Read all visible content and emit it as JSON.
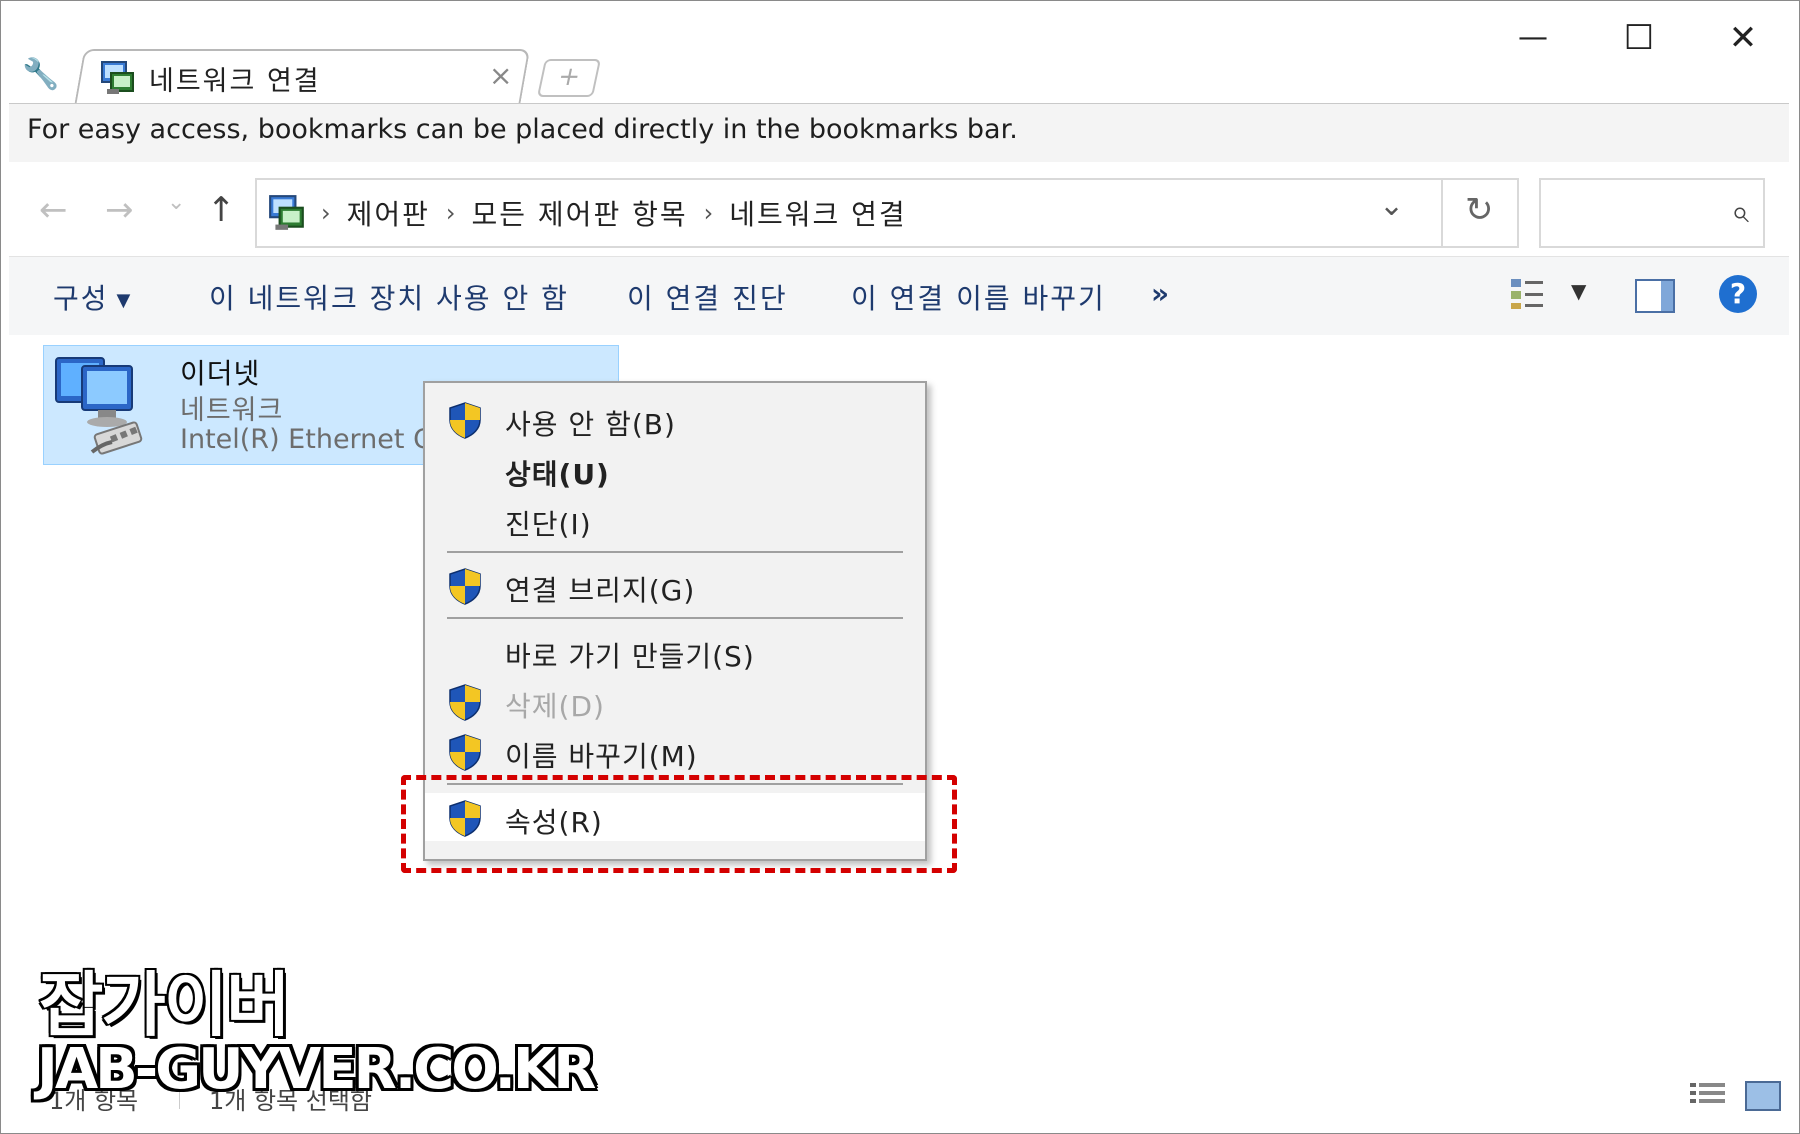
{
  "titlebar": {
    "tab_title": "네트워크 연결",
    "tab_close": "×",
    "new_tab": "+",
    "minimize": "—",
    "maximize": "☐",
    "close": "✕"
  },
  "bookmark_bar": {
    "message": "For easy access, bookmarks can be placed directly in the bookmarks bar."
  },
  "address": {
    "back": "←",
    "forward": "→",
    "recent": "⌄",
    "up": "↑",
    "crumbs": [
      "제어판",
      "모든 제어판 항목",
      "네트워크 연결"
    ],
    "separator": "›",
    "dropdown": "⌄",
    "refresh": "↻",
    "search_placeholder": ""
  },
  "commandbar": {
    "organize": "구성",
    "disable": "이 네트워크 장치 사용 안 함",
    "diagnose": "이 연결 진단",
    "rename": "이 연결 이름 바꾸기",
    "more": "»",
    "help": "?"
  },
  "item": {
    "name": "이더넷",
    "type": "네트워크",
    "device": "Intel(R) Ethernet Con"
  },
  "context_menu": {
    "items": [
      {
        "label": "사용 안 함(B)",
        "shield": true
      },
      {
        "label": "상태(U)",
        "shield": false,
        "bold": true
      },
      {
        "label": "진단(I)",
        "shield": false
      },
      {
        "label": "연결 브리지(G)",
        "shield": true
      },
      {
        "label": "바로 가기 만들기(S)",
        "shield": false
      },
      {
        "label": "삭제(D)",
        "shield": true,
        "disabled": true
      },
      {
        "label": "이름 바꾸기(M)",
        "shield": true
      },
      {
        "label": "속성(R)",
        "shield": true,
        "highlighted": true
      }
    ]
  },
  "statusbar": {
    "count": "1개 항목",
    "selected": "1개 항목 선택함"
  },
  "watermark": {
    "korean": "잡가이버",
    "english": "JAB-GUYVER.CO.KR"
  },
  "colors": {
    "selection_bg": "#cce8ff",
    "highlight_border": "#d40000",
    "command_text": "#1e3a6e"
  }
}
